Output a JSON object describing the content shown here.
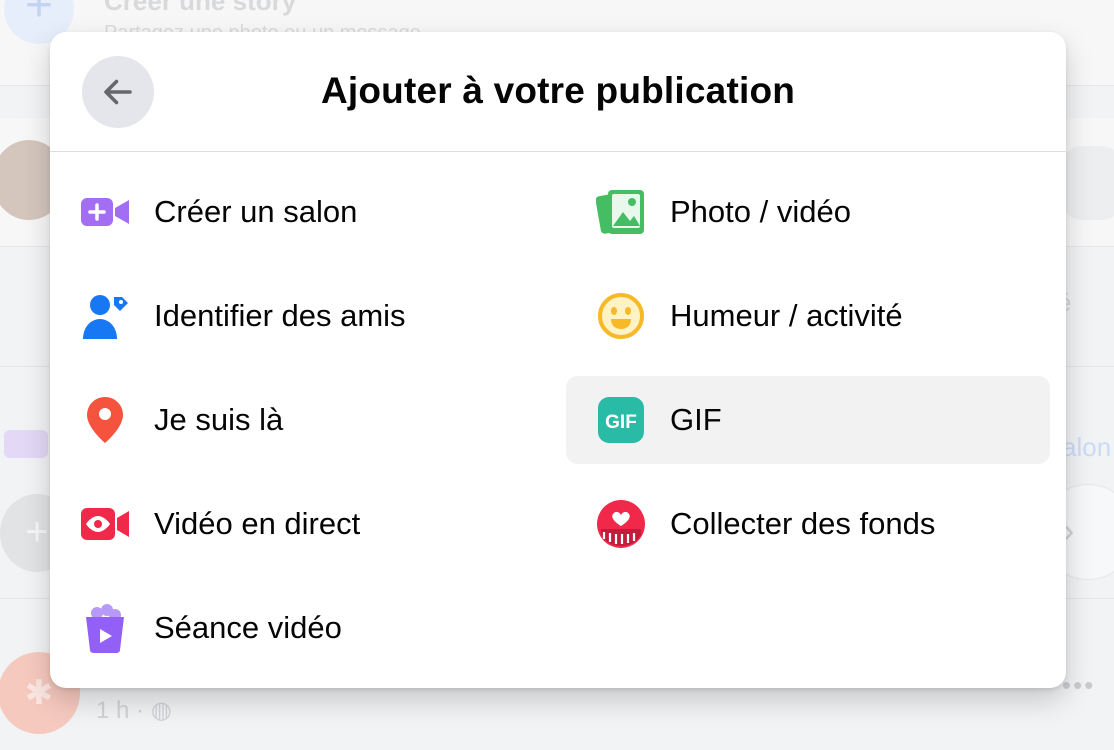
{
  "background": {
    "story_title": "Créer une story",
    "story_subtitle": "Partagez une photo ou un message",
    "right_fragment_1": "é",
    "right_fragment_2": "alon",
    "post_meta": "1 h ·",
    "more_menu": "•••"
  },
  "modal": {
    "title": "Ajouter à votre publication",
    "back_icon": "arrow-left-icon",
    "options": [
      {
        "label": "Créer un salon",
        "icon": "video-room-icon",
        "color": "#a36ef4"
      },
      {
        "label": "Photo / vidéo",
        "icon": "photo-video-icon",
        "color": "#45bd62"
      },
      {
        "label": "Identifier des amis",
        "icon": "tag-friends-icon",
        "color": "#1877f2"
      },
      {
        "label": "Humeur / activité",
        "icon": "smiley-icon",
        "color": "#f7b928"
      },
      {
        "label": "Je suis là",
        "icon": "location-pin-icon",
        "color": "#f5533d"
      },
      {
        "label": "GIF",
        "icon": "gif-icon",
        "color": "#2abba7",
        "icon_text": "GIF"
      },
      {
        "label": "Vidéo en direct",
        "icon": "live-video-icon",
        "color": "#f02849"
      },
      {
        "label": "Collecter des fonds",
        "icon": "fundraiser-icon",
        "color": "#f02849"
      },
      {
        "label": "Séance vidéo",
        "icon": "watch-party-icon",
        "color": "#9360f7"
      }
    ]
  }
}
